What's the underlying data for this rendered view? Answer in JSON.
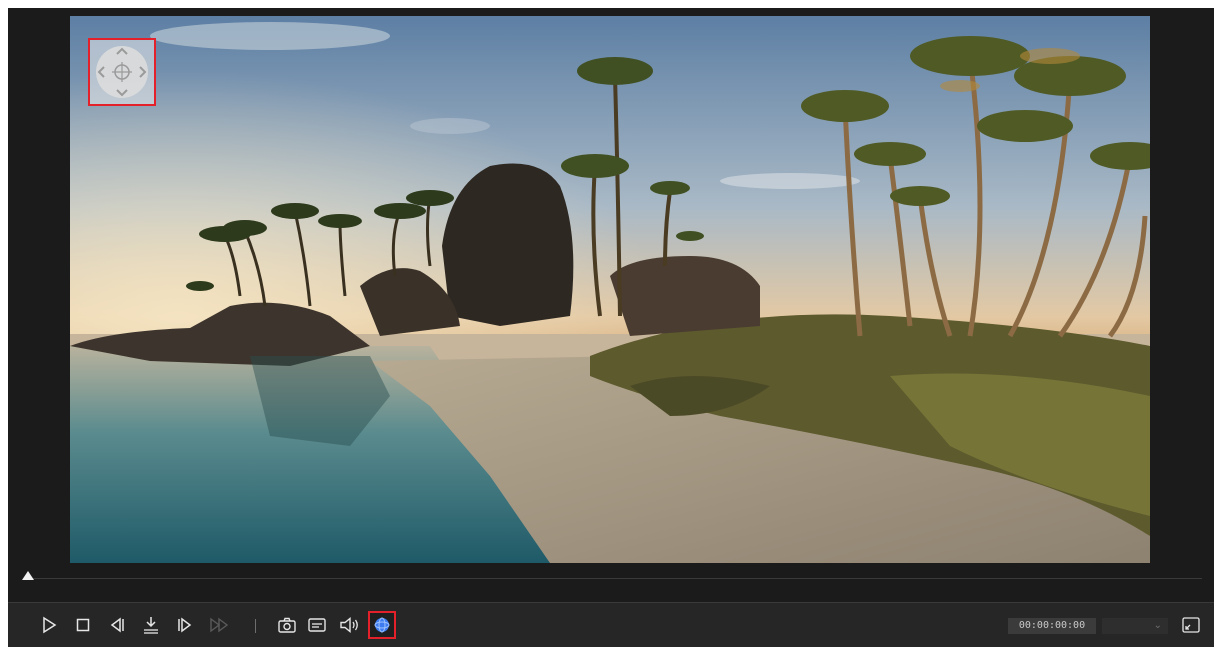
{
  "player": {
    "timecode": "00:00:00:00",
    "speed_value": "",
    "seek_progress": 0
  },
  "navigator": {
    "icon": "navigation-360-icon"
  },
  "toolbar": {
    "buttons": [
      {
        "name": "play-button",
        "icon": "play-icon"
      },
      {
        "name": "stop-button",
        "icon": "stop-icon"
      },
      {
        "name": "previous-frame-button",
        "icon": "previous-frame-icon"
      },
      {
        "name": "mark-button",
        "icon": "mark-icon"
      },
      {
        "name": "next-frame-button",
        "icon": "next-frame-icon"
      },
      {
        "name": "fast-forward-button",
        "icon": "fast-forward-icon",
        "disabled": true
      },
      {
        "name": "snapshot-button",
        "icon": "camera-icon"
      },
      {
        "name": "subtitle-button",
        "icon": "subtitle-icon"
      },
      {
        "name": "volume-button",
        "icon": "speaker-icon"
      },
      {
        "name": "view-360-button",
        "icon": "globe-icon",
        "highlighted": true
      },
      {
        "name": "fullscreen-button",
        "icon": "expand-screen-icon"
      }
    ]
  },
  "colors": {
    "highlight": "#e4212a",
    "panel": "#1b1b1b",
    "accent_blue": "#3d7cf0"
  }
}
